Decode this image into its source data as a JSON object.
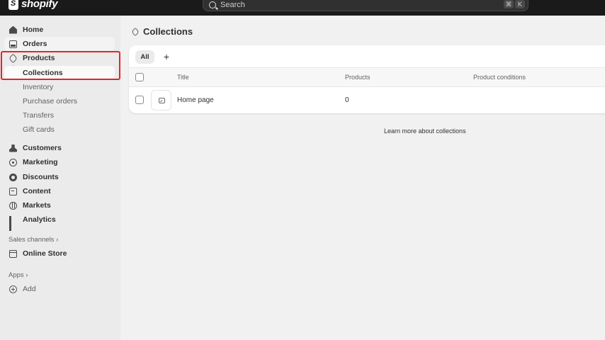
{
  "topbar": {
    "brand": "shopify",
    "search_placeholder": "Search",
    "shortcut_keys": [
      "⌘",
      "K"
    ]
  },
  "sidebar": {
    "items": [
      {
        "label": "Home",
        "icon": "home-icon"
      },
      {
        "label": "Orders",
        "icon": "orders-icon"
      },
      {
        "label": "Products",
        "icon": "tag-icon"
      },
      {
        "label": "Collections",
        "active": true
      },
      {
        "label": "Inventory"
      },
      {
        "label": "Purchase orders"
      },
      {
        "label": "Transfers"
      },
      {
        "label": "Gift cards"
      },
      {
        "label": "Customers",
        "icon": "person-icon"
      },
      {
        "label": "Marketing",
        "icon": "target-icon"
      },
      {
        "label": "Discounts",
        "icon": "discount-icon"
      },
      {
        "label": "Content",
        "icon": "content-icon"
      },
      {
        "label": "Markets",
        "icon": "globe-icon"
      },
      {
        "label": "Analytics",
        "icon": "bar-chart-icon"
      }
    ],
    "sales_channels_label": "Sales channels ›",
    "online_store_label": "Online Store",
    "apps_label": "Apps ›",
    "add_label": "Add"
  },
  "main": {
    "title": "Collections",
    "tabs": {
      "all": "All",
      "add": "+"
    },
    "columns": [
      "Title",
      "Products",
      "Product conditions"
    ],
    "rows": [
      {
        "title": "Home page",
        "products": "0",
        "conditions": ""
      }
    ],
    "learn_more": "Learn more about collections"
  },
  "colors": {
    "topbar": "#1a1a1a",
    "sidebar": "#ebebeb",
    "highlight": "#e0262a"
  }
}
